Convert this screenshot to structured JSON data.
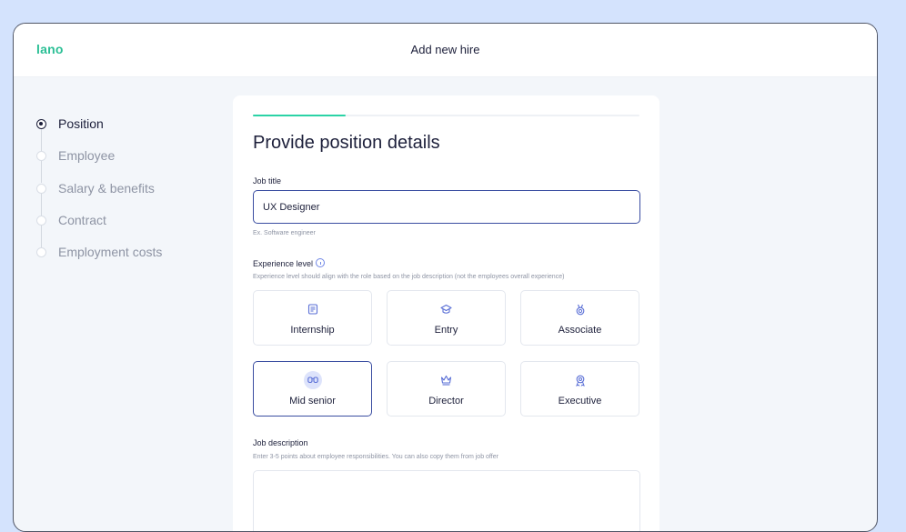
{
  "header": {
    "logo": "lano",
    "title": "Add new hire"
  },
  "steps": [
    {
      "label": "Position",
      "active": true
    },
    {
      "label": "Employee",
      "active": false
    },
    {
      "label": "Salary & benefits",
      "active": false
    },
    {
      "label": "Contract",
      "active": false
    },
    {
      "label": "Employment costs",
      "active": false
    }
  ],
  "form": {
    "progress": 0.24,
    "title": "Provide position details",
    "job_title": {
      "label": "Job title",
      "value": "UX Designer",
      "hint": "Ex. Software engineer"
    },
    "experience": {
      "label": "Experience level",
      "hint": "Experience level should align with the role based on the job description (not the employees overall experience)",
      "options": [
        {
          "label": "Internship",
          "icon": "document-icon",
          "selected": false
        },
        {
          "label": "Entry",
          "icon": "graduation-cap-icon",
          "selected": false
        },
        {
          "label": "Associate",
          "icon": "medal-icon",
          "selected": false
        },
        {
          "label": "Mid senior",
          "icon": "glasses-icon",
          "selected": true
        },
        {
          "label": "Director",
          "icon": "crown-icon",
          "selected": false
        },
        {
          "label": "Executive",
          "icon": "award-icon",
          "selected": false
        }
      ]
    },
    "job_description": {
      "label": "Job description",
      "hint": "Enter 3-5 points about employee responsibilities. You can also copy them from job offer",
      "value": ""
    }
  },
  "colors": {
    "accent": "#3a4da1",
    "brand": "#2bbf95",
    "progress": "#2bd3a6",
    "icon": "#5a6fd6"
  }
}
